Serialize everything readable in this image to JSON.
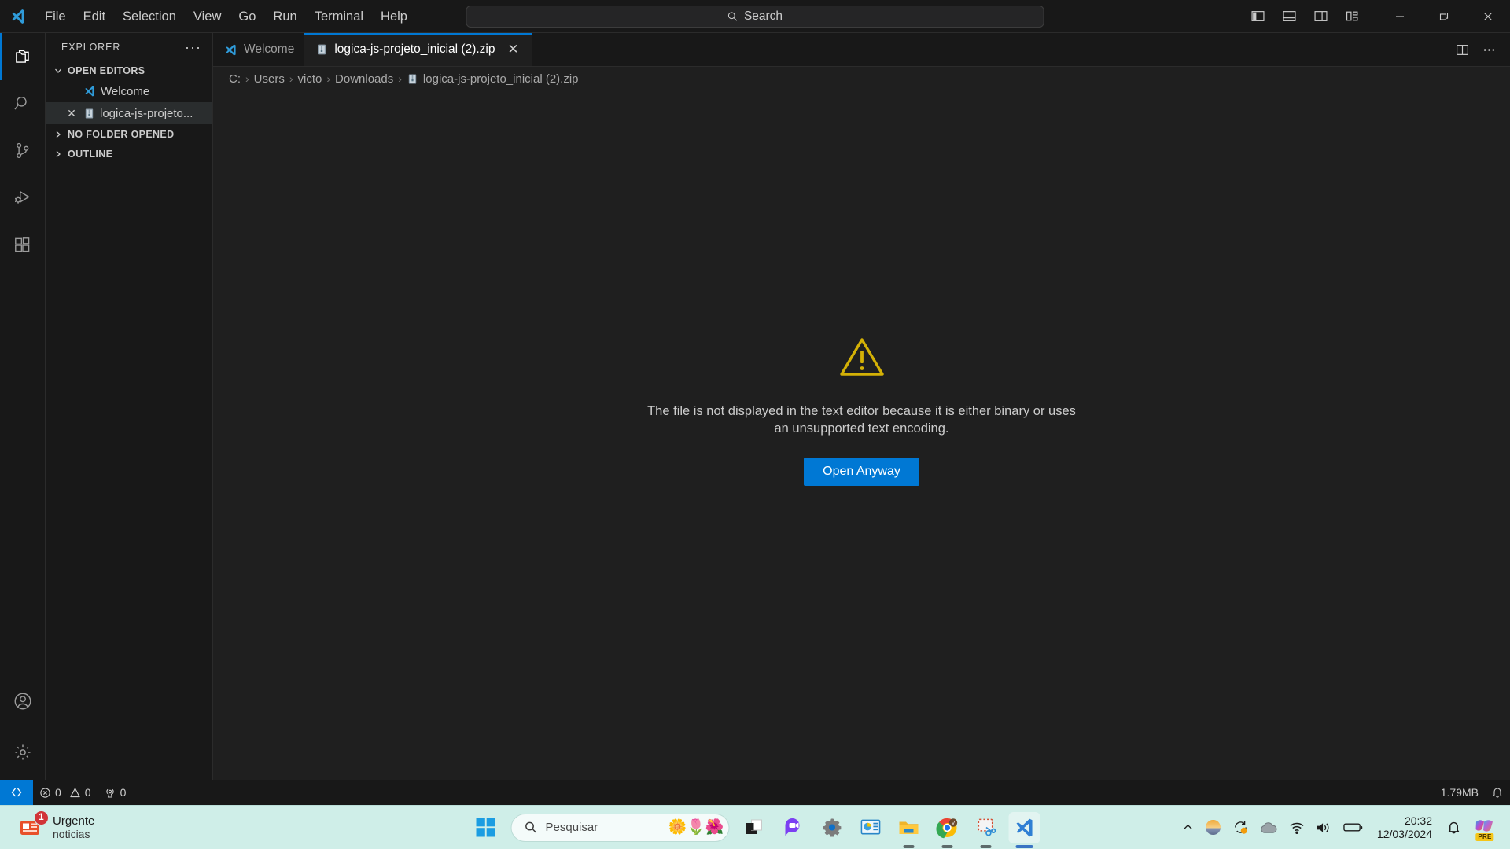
{
  "titlebar": {
    "menus": [
      "File",
      "Edit",
      "Selection",
      "View",
      "Go",
      "Run",
      "Terminal",
      "Help"
    ],
    "nav_back": "back-arrow",
    "nav_forward": "forward-arrow",
    "search_placeholder": "Search",
    "layout_buttons": [
      "toggle-primary-sidebar",
      "toggle-panel",
      "toggle-secondary-sidebar",
      "customize-layout"
    ],
    "window_controls": [
      "minimize",
      "maximize",
      "close"
    ]
  },
  "activitybar": {
    "items": [
      {
        "name": "explorer",
        "icon": "files-icon",
        "active": true
      },
      {
        "name": "search",
        "icon": "search-icon",
        "active": false
      },
      {
        "name": "source-control",
        "icon": "source-control-icon",
        "active": false
      },
      {
        "name": "run-and-debug",
        "icon": "run-debug-icon",
        "active": false
      },
      {
        "name": "extensions",
        "icon": "extensions-icon",
        "active": false
      }
    ],
    "bottom": [
      {
        "name": "accounts",
        "icon": "account-icon"
      },
      {
        "name": "manage",
        "icon": "gear-icon"
      }
    ]
  },
  "sidebar": {
    "title": "EXPLORER",
    "more_actions": "···",
    "sections": [
      {
        "label": "OPEN EDITORS",
        "expanded": true
      },
      {
        "label": "NO FOLDER OPENED",
        "expanded": false
      },
      {
        "label": "OUTLINE",
        "expanded": false
      }
    ],
    "open_editors": [
      {
        "label": "Welcome",
        "icon": "vscode-logo-icon",
        "selected": false,
        "has_close": false
      },
      {
        "label": "logica-js-projeto...",
        "icon": "zip-file-icon",
        "selected": true,
        "has_close": true
      }
    ]
  },
  "editor": {
    "tabs": [
      {
        "label": "Welcome",
        "icon": "vscode-logo-icon",
        "active": false,
        "has_close": false
      },
      {
        "label": "logica-js-projeto_inicial (2).zip",
        "icon": "zip-file-icon",
        "active": true,
        "has_close": true,
        "close_glyph": "✕"
      }
    ],
    "tab_actions": [
      "split-editor",
      "more-actions"
    ],
    "breadcrumbs": [
      {
        "label": "C:",
        "icon": null
      },
      {
        "label": "Users",
        "icon": null
      },
      {
        "label": "victo",
        "icon": null
      },
      {
        "label": "Downloads",
        "icon": null
      },
      {
        "label": "logica-js-projeto_inicial (2).zip",
        "icon": "zip-file-icon"
      }
    ],
    "breadcrumb_separator": "›",
    "binary_warning": {
      "icon": "warning-triangle-icon",
      "icon_color": "#d4b106",
      "message": "The file is not displayed in the text editor because it is either binary or uses an unsupported text encoding.",
      "button_label": "Open Anyway",
      "button_color": "#0078d4"
    }
  },
  "statusbar": {
    "remote_icon": "remote-window-icon",
    "remote_color": "#0078d4",
    "errors": "0",
    "warnings": "0",
    "ports": "0",
    "editor_size": "1.79MB",
    "notifications_icon": "bell-icon"
  },
  "taskbar": {
    "background": "#cfeee8",
    "news": {
      "title": "Urgente",
      "subtitle": "noticias",
      "badge": "1",
      "icon": "news-icon"
    },
    "start_button": "windows-start-icon",
    "search": {
      "placeholder": "Pesquisar",
      "icon": "search-icon",
      "decoration": "flowers-icon"
    },
    "apps": [
      {
        "name": "task-view",
        "icon": "task-view-icon",
        "running": false,
        "active": false
      },
      {
        "name": "teams",
        "icon": "teams-chat-icon",
        "running": false,
        "active": false
      },
      {
        "name": "settings",
        "icon": "settings-gear-icon",
        "running": false,
        "active": false
      },
      {
        "name": "powerpoint",
        "icon": "presentation-icon",
        "running": false,
        "active": false
      },
      {
        "name": "file-explorer",
        "icon": "folder-icon",
        "running": true,
        "active": false
      },
      {
        "name": "chrome",
        "icon": "chrome-icon",
        "running": true,
        "active": false,
        "avatar": "V"
      },
      {
        "name": "snipping-tool",
        "icon": "snipping-tool-icon",
        "running": true,
        "active": false
      },
      {
        "name": "vscode",
        "icon": "vscode-logo-icon",
        "running": false,
        "active": true
      }
    ],
    "tray": [
      {
        "name": "show-hidden-icons",
        "icon": "chevron-up-icon"
      },
      {
        "name": "weather-or-app",
        "icon": "circle-gradient-icon"
      },
      {
        "name": "windows-update",
        "icon": "sync-icon"
      },
      {
        "name": "onedrive",
        "icon": "cloud-icon"
      },
      {
        "name": "network",
        "icon": "wifi-icon"
      },
      {
        "name": "volume",
        "icon": "speaker-icon"
      },
      {
        "name": "battery",
        "icon": "battery-icon"
      }
    ],
    "clock": {
      "time": "20:32",
      "date": "12/03/2024"
    },
    "notification_icon": "bell-icon",
    "copilot": {
      "icon": "copilot-icon",
      "tag": "PRE"
    }
  }
}
